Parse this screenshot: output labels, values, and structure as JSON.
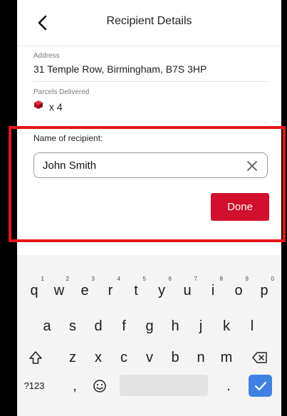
{
  "header": {
    "title": "Recipient Details",
    "back_icon": "chevron-left-icon"
  },
  "address": {
    "label": "Address",
    "value": "31 Temple Row, Birmingham, B7S 3HP"
  },
  "parcels": {
    "label": "Parcels Delivered",
    "icon": "parcel-box-icon",
    "count": "x 4",
    "icon_color": "#c8102e"
  },
  "recipient": {
    "label": "Name of recipient:",
    "value": "John Smith",
    "clear_icon": "clear-x-icon"
  },
  "done_button": {
    "label": "Done",
    "color": "#d3102c"
  },
  "highlight_color": "#e8141c",
  "keyboard": {
    "row1": [
      {
        "k": "q",
        "n": "1"
      },
      {
        "k": "w",
        "n": "2"
      },
      {
        "k": "e",
        "n": "3"
      },
      {
        "k": "r",
        "n": "4"
      },
      {
        "k": "t",
        "n": "5"
      },
      {
        "k": "y",
        "n": "6"
      },
      {
        "k": "u",
        "n": "7"
      },
      {
        "k": "i",
        "n": "8"
      },
      {
        "k": "o",
        "n": "9"
      },
      {
        "k": "p",
        "n": "0"
      }
    ],
    "row2": [
      "a",
      "s",
      "d",
      "f",
      "g",
      "h",
      "j",
      "k",
      "l"
    ],
    "row3": [
      "z",
      "x",
      "c",
      "v",
      "b",
      "n",
      "m"
    ],
    "symbols_key": "?123",
    "comma_key": ",",
    "period_key": ".",
    "shift_icon": "shift-icon",
    "backspace_icon": "backspace-icon",
    "emoji_icon": "emoji-icon",
    "enter_icon": "checkmark-icon",
    "enter_color": "#3d82e4"
  }
}
